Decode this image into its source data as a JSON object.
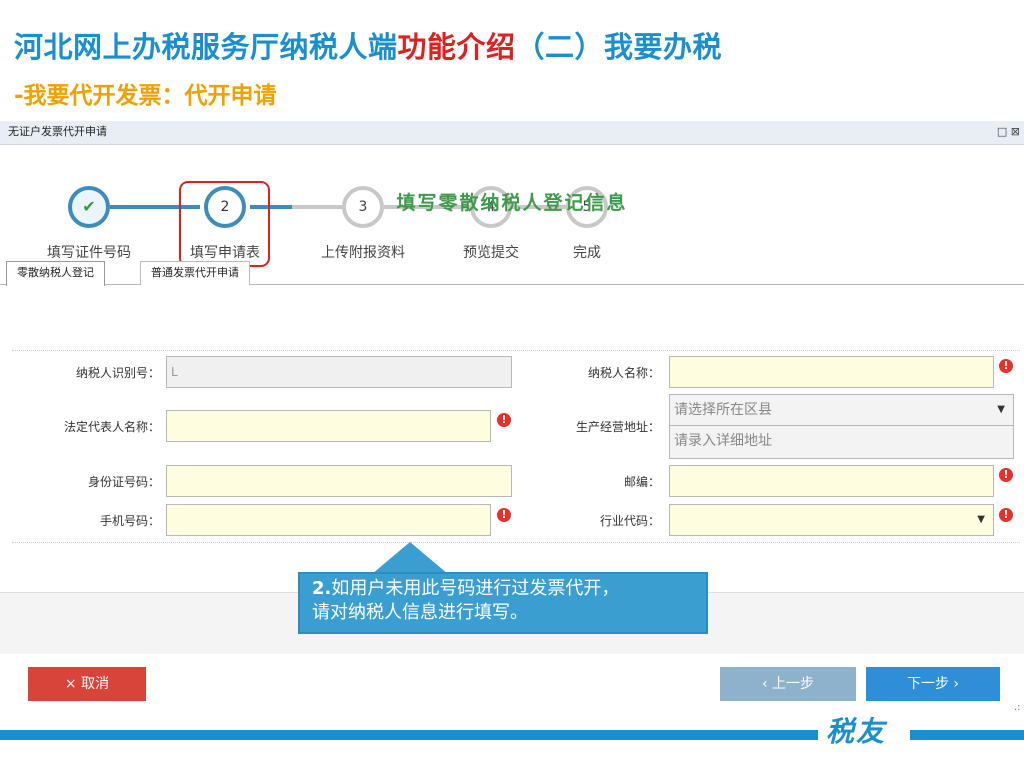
{
  "slide": {
    "title_main": "河北网上办税服务厅纳税人端",
    "title_highlight": "功能介绍",
    "title_tail": "（二）我要办税",
    "subtitle": "-我要代开发票：代开申请"
  },
  "window": {
    "title": "无证户发票代开申请",
    "controls": "□ ⊠"
  },
  "steps": [
    {
      "num": "✔",
      "label": "填写证件号码",
      "state": "done"
    },
    {
      "num": "2",
      "label": "填写申请表",
      "state": "current"
    },
    {
      "num": "3",
      "label": "上传附报资料",
      "state": "todo"
    },
    {
      "num": "4",
      "label": "预览提交",
      "state": "todo"
    },
    {
      "num": "5",
      "label": "完成",
      "state": "todo"
    }
  ],
  "tabs": [
    {
      "label": "零散纳税人登记",
      "active": true
    },
    {
      "label": "普通发票代开申请",
      "active": false
    }
  ],
  "form": {
    "title": "填写零散纳税人登记信息",
    "taxpayer_id": {
      "label": "纳税人识别号：",
      "value": "L"
    },
    "taxpayer_name": {
      "label": "纳税人名称：",
      "value": ""
    },
    "legal_rep": {
      "label": "法定代表人名称：",
      "value": ""
    },
    "address": {
      "label": "生产经营地址：",
      "district_placeholder": "请选择所在区县",
      "detail_placeholder": "请录入详细地址"
    },
    "id_card": {
      "label": "身份证号码：",
      "value": ""
    },
    "postcode": {
      "label": "邮编：",
      "value": ""
    },
    "mobile": {
      "label": "手机号码：",
      "value": ""
    },
    "industry": {
      "label": "行业代码：",
      "value": ""
    }
  },
  "callout": {
    "line1_num": "2.",
    "line1": "如用户未用此号码进行过发票代开，",
    "line2": "请对纳税人信息进行填写。"
  },
  "buttons": {
    "cancel": "× 取消",
    "prev": "‹ 上一步",
    "next": "下一步 ›"
  },
  "footer": {
    "logo": "税友"
  },
  "colors": {
    "title_blue": "#1a8fd0",
    "title_red": "#e02020",
    "subtitle_orange": "#f0a000",
    "step_blue": "#3c8dbc",
    "field_yellow": "#fffde0",
    "error_red": "#e8302a",
    "cancel_red": "#d9443a",
    "next_blue": "#2f8ed8",
    "callout_blue": "#3a9fd0"
  }
}
